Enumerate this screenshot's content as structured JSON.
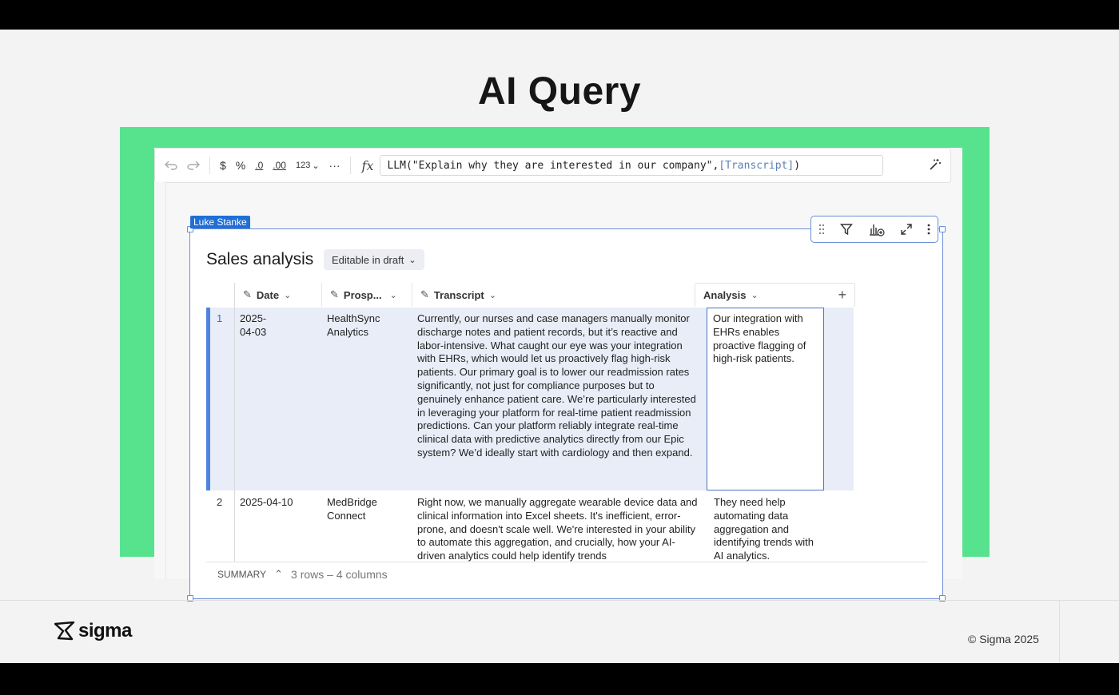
{
  "slide": {
    "title": "AI Query",
    "footer_logo_text": "sigma",
    "copyright": "© Sigma 2025"
  },
  "toolbar": {
    "undo_icon": "undo-icon",
    "redo_icon": "redo-icon",
    "currency_label": "$",
    "percent_label": "%",
    "decrease_decimals_label": ".0",
    "increase_decimals_label": ".00",
    "number_format_label": "123",
    "more_label": "···",
    "fx_label": "fx",
    "formula_text": "LLM(\"Explain why they are interested in our company\", ",
    "formula_ref": "[Transcript]",
    "formula_close": ")"
  },
  "element": {
    "editor_tag": "Luke Stanke",
    "title": "Sales analysis",
    "badge": "Editable in draft",
    "icons": [
      "drag-handle-icon",
      "filter-icon",
      "add-chart-icon",
      "expand-icon",
      "more-vertical-icon"
    ]
  },
  "table": {
    "columns": [
      {
        "label": "Date"
      },
      {
        "label": "Prosp..."
      },
      {
        "label": "Transcript"
      },
      {
        "label": "Analysis"
      }
    ],
    "rows": [
      {
        "num": "1",
        "date": "2025-04-03",
        "prospect": "HealthSync Analytics",
        "transcript": "Currently, our nurses and case managers manually monitor discharge notes and patient records, but it’s reactive and labor-intensive. What caught our eye was your integration with EHRs, which would let us proactively flag high-risk patients. Our primary goal is to lower our readmission rates significantly, not just for compliance purposes but to genuinely enhance patient care. We’re particularly interested in leveraging your platform for real-time patient readmission predictions. Can your platform reliably integrate real-time clinical data with predictive analytics directly from our Epic system? We’d ideally start with cardiology and then expand.",
        "analysis": "Our integration with EHRs enables proactive flagging of high-risk patients."
      },
      {
        "num": "2",
        "date": "2025-04-10",
        "prospect": "MedBridge Connect",
        "transcript": "Right now, we manually aggregate wearable device data and clinical information into Excel sheets. It's inefficient, error-prone, and doesn't scale well. We're interested in your ability to automate this aggregation, and crucially, how your AI-driven analytics could help identify trends",
        "analysis": "They need help automating data aggregation and identifying trends with AI analytics."
      }
    ],
    "summary_label": "SUMMARY",
    "summary_counts": "3 rows – 4 columns"
  }
}
